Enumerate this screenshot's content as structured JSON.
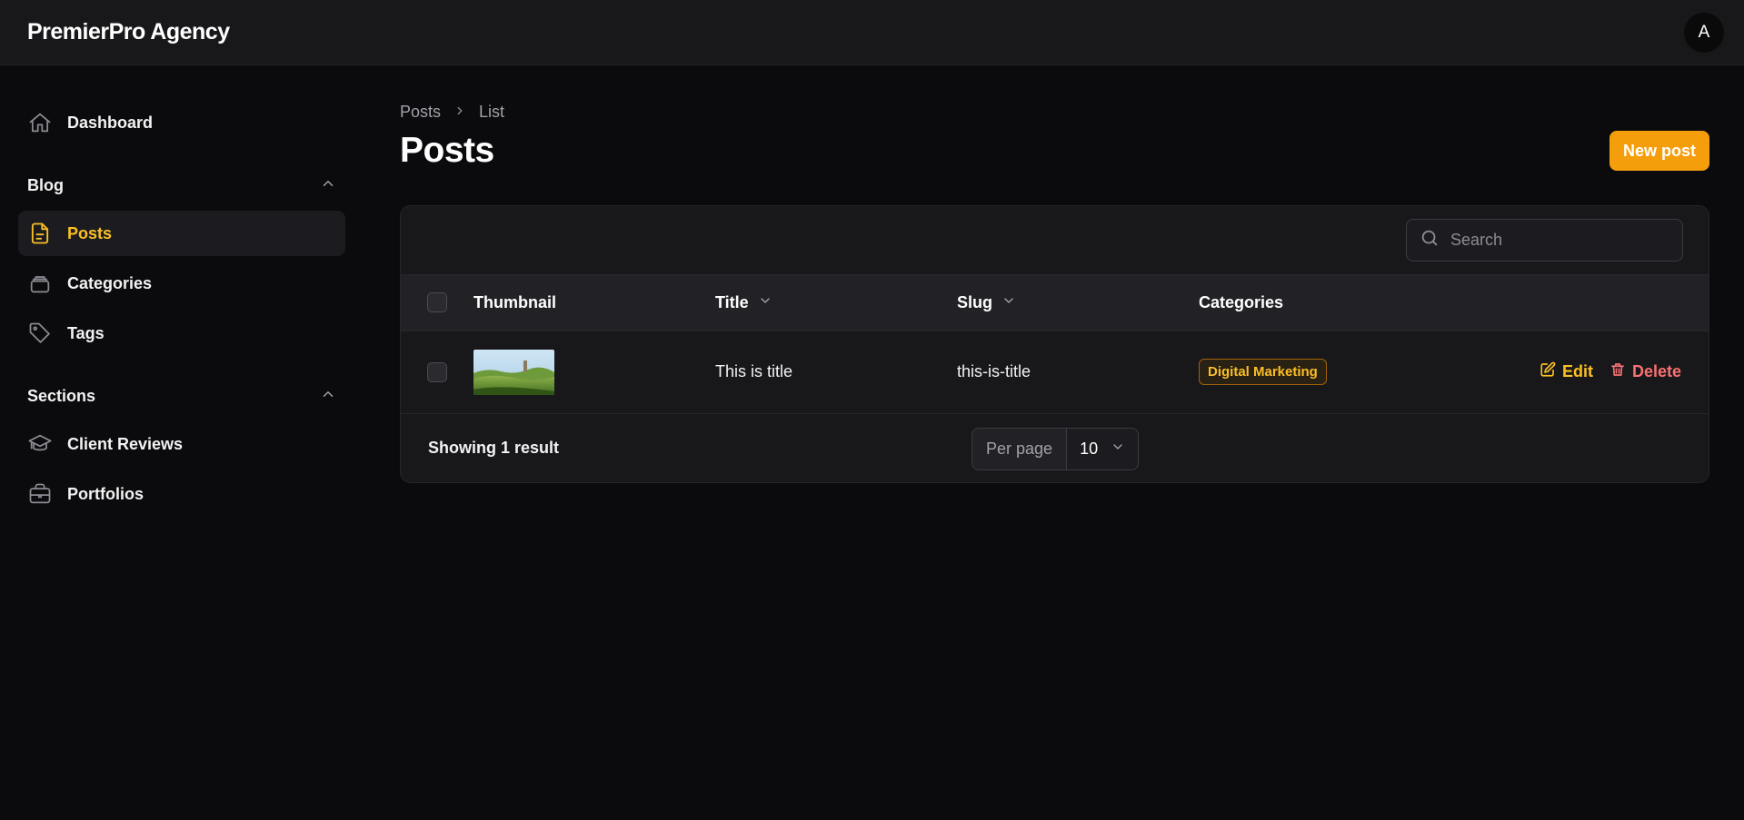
{
  "app": {
    "brand": "PremierPro Agency",
    "avatar_initial": "A"
  },
  "sidebar": {
    "dashboard": {
      "label": "Dashboard",
      "icon": "home-icon"
    },
    "groups": [
      {
        "label": "Blog",
        "items": [
          {
            "label": "Posts",
            "icon": "document-icon",
            "active": true
          },
          {
            "label": "Categories",
            "icon": "stack-icon"
          },
          {
            "label": "Tags",
            "icon": "tag-icon"
          }
        ]
      },
      {
        "label": "Sections",
        "items": [
          {
            "label": "Client Reviews",
            "icon": "academic-cap-icon"
          },
          {
            "label": "Portfolios",
            "icon": "briefcase-icon"
          }
        ]
      }
    ]
  },
  "breadcrumb": {
    "first": "Posts",
    "second": "List"
  },
  "page": {
    "title": "Posts",
    "new_button": "New post"
  },
  "table": {
    "search_placeholder": "Search",
    "columns": {
      "thumbnail": "Thumbnail",
      "title": "Title",
      "slug": "Slug",
      "categories": "Categories"
    },
    "rows": [
      {
        "title": "This is title",
        "slug": "this-is-title",
        "category": "Digital Marketing",
        "edit": "Edit",
        "delete": "Delete"
      }
    ],
    "result_text": "Showing 1 result",
    "per_page_label": "Per page",
    "per_page_value": "10"
  },
  "colors": {
    "accent": "#f59e0b",
    "active_text": "#fbbf24",
    "danger": "#f87171",
    "background": "#0b0b0d",
    "surface": "#18181b"
  }
}
